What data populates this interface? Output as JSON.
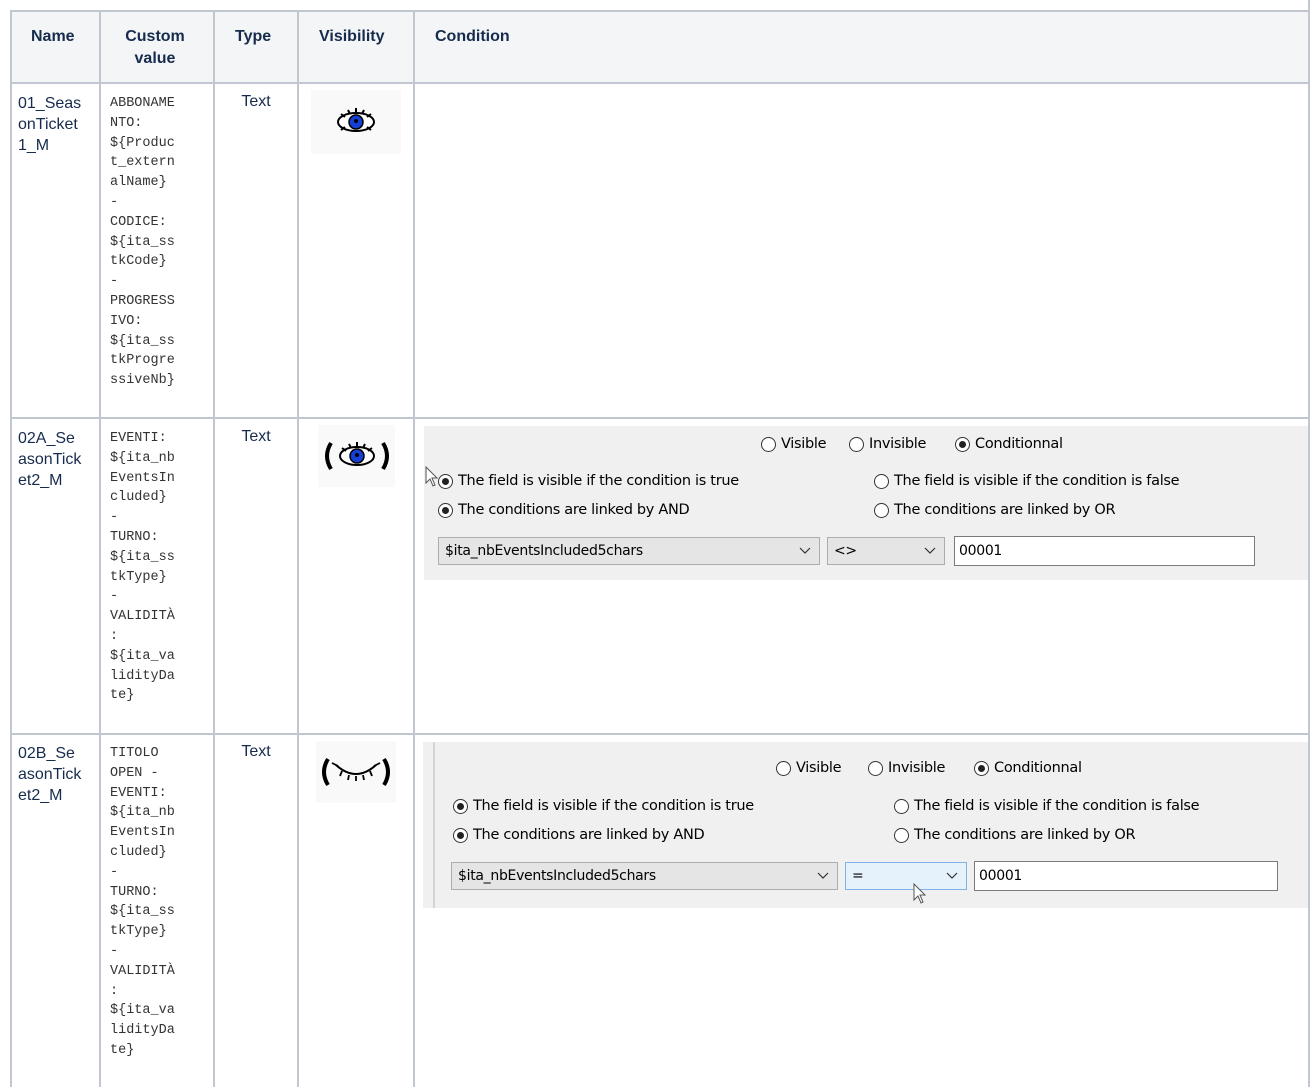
{
  "headers": {
    "name": "Name",
    "custom_value": "Custom\nvalue",
    "type": "Type",
    "visibility": "Visibility",
    "condition": "Condition"
  },
  "rows": [
    {
      "name": "01_Seas\nonTicket\n1_M",
      "custom_value": "ABBONAME\nNTO:\n${Produc\nt_extern\nalName}\n-\nCODICE:\n${ita_ss\ntkCode}\n-\nPROGRESS\nIVO:\n${ita_ss\ntkProgre\nssiveNb}",
      "type": "Text",
      "visibility_icon": "visible-eye-icon"
    },
    {
      "name": "02A_Se\nasonTick\net2_M",
      "custom_value": "EVENTI:\n${ita_nb\nEventsIn\ncluded}\n-\nTURNO:\n${ita_ss\ntkType}\n-\nVALIDITÀ\n:\n${ita_va\nlidityDa\nte}",
      "type": "Text",
      "visibility_icon": "conditional-eye-icon",
      "condition": {
        "visibility_options": [
          "Visible",
          "Invisible",
          "Conditionnal"
        ],
        "selected_visibility": "Conditionnal",
        "visible_if_true": "The field is visible if the condition is true",
        "visible_if_false": "The field is visible if the condition is false",
        "linked_and": "The conditions are linked by AND",
        "linked_or": "The conditions are linked by OR",
        "field": "$ita_nbEventsIncluded5chars",
        "operator": "<>",
        "value": "00001"
      }
    },
    {
      "name": "02B_Se\nasonTick\net2_M",
      "custom_value": "TITOLO\nOPEN -\nEVENTI:\n${ita_nb\nEventsIn\ncluded}\n-\nTURNO:\n${ita_ss\ntkType}\n-\nVALIDITÀ\n:\n${ita_va\nlidityDa\nte}",
      "type": "Text",
      "visibility_icon": "conditional-closed-eye-icon",
      "condition": {
        "visibility_options": [
          "Visible",
          "Invisible",
          "Conditionnal"
        ],
        "selected_visibility": "Conditionnal",
        "visible_if_true": "The field is visible if the condition is true",
        "visible_if_false": "The field is visible if the condition is false",
        "linked_and": "The conditions are linked by AND",
        "linked_or": "The conditions are linked by OR",
        "field": "$ita_nbEventsIncluded5chars",
        "operator": "=",
        "value": "00001"
      }
    }
  ]
}
